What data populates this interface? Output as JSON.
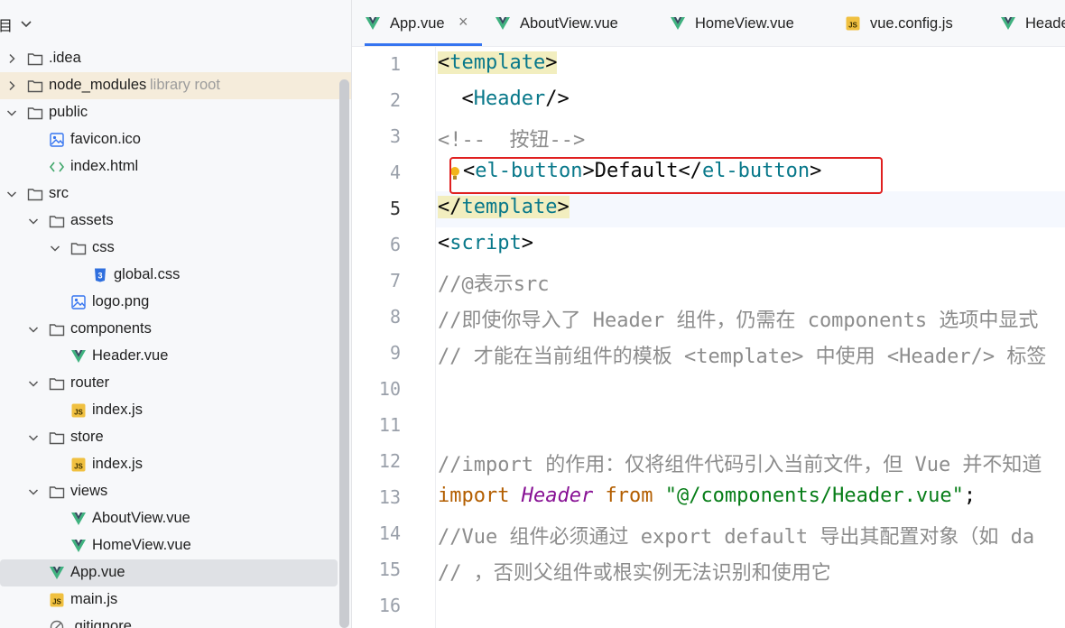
{
  "project": {
    "title": "目",
    "tree": [
      {
        "label": ".idea",
        "icon": "folder-icon",
        "state": "collapsed"
      },
      {
        "label": "node_modules",
        "hint": "library root",
        "icon": "folder-icon",
        "state": "collapsed"
      },
      {
        "label": "public",
        "icon": "folder-icon",
        "state": "expanded"
      },
      {
        "label": "favicon.ico",
        "icon": "image-file-icon"
      },
      {
        "label": "index.html",
        "icon": "html-file-icon"
      },
      {
        "label": "src",
        "icon": "folder-icon",
        "state": "expanded"
      },
      {
        "label": "assets",
        "icon": "folder-icon",
        "state": "expanded"
      },
      {
        "label": "css",
        "icon": "folder-icon",
        "state": "expanded"
      },
      {
        "label": "global.css",
        "icon": "css-file-icon"
      },
      {
        "label": "logo.png",
        "icon": "image-file-icon"
      },
      {
        "label": "components",
        "icon": "folder-icon",
        "state": "expanded"
      },
      {
        "label": "Header.vue",
        "icon": "vue-file-icon"
      },
      {
        "label": "router",
        "icon": "folder-icon",
        "state": "expanded"
      },
      {
        "label": "index.js",
        "icon": "js-file-icon"
      },
      {
        "label": "store",
        "icon": "folder-icon",
        "state": "expanded"
      },
      {
        "label": "index.js",
        "icon": "js-file-icon"
      },
      {
        "label": "views",
        "icon": "folder-icon",
        "state": "expanded"
      },
      {
        "label": "AboutView.vue",
        "icon": "vue-file-icon"
      },
      {
        "label": "HomeView.vue",
        "icon": "vue-file-icon"
      },
      {
        "label": "App.vue",
        "icon": "vue-file-icon",
        "selected": true
      },
      {
        "label": "main.js",
        "icon": "js-file-icon"
      },
      {
        "label": ".gitignore",
        "icon": "gitignore-icon"
      }
    ]
  },
  "editor": {
    "tabs": [
      {
        "label": "App.vue",
        "icon": "vue-file-icon",
        "active": true
      },
      {
        "label": "AboutView.vue",
        "icon": "vue-file-icon"
      },
      {
        "label": "HomeView.vue",
        "icon": "vue-file-icon"
      },
      {
        "label": "vue.config.js",
        "icon": "js-file-icon"
      },
      {
        "label": "Heade",
        "icon": "vue-file-icon"
      }
    ],
    "close_glyph": "×",
    "line_numbers": [
      "1",
      "2",
      "3",
      "4",
      "5",
      "6",
      "7",
      "8",
      "9",
      "10",
      "11",
      "12",
      "13",
      "14",
      "15",
      "16"
    ],
    "current_line": "5",
    "lines": {
      "l1": {
        "open": "<",
        "name": "template",
        "close": ">"
      },
      "l2": {
        "indent": "  ",
        "open": "<",
        "name": "Header",
        "close": "/>"
      },
      "l3": {
        "text": "<!--  按钮-->"
      },
      "l4": {
        "open": "<",
        "name": "el-button",
        "close": ">",
        "content": "Default",
        "end_open": "</",
        "end_name": "el-button",
        "end_close": ">"
      },
      "l5": {
        "open": "</",
        "name": "template",
        "close": ">"
      },
      "l6": {
        "open": "<",
        "name": "script",
        "close": ">"
      },
      "l7": {
        "text": "//@表示src"
      },
      "l8": {
        "text": "//即使你导入了 Header 组件，仍需在 components 选项中显式"
      },
      "l9": {
        "text": "// 才能在当前组件的模板 <template> 中使用 <Header/> 标签"
      },
      "l12": {
        "text": "//import 的作用：仅将组件代码引入当前文件，但 Vue 并不知道"
      },
      "l13": {
        "kw": "import",
        "ident": "Header",
        "from": "from",
        "str": "\"@/components/Header.vue\"",
        "semi": ";"
      },
      "l14": {
        "text": "//Vue 组件必须通过 export default 导出其配置对象（如 da"
      },
      "l15": {
        "text": "// ，否则父组件或根实例无法识别和使用它"
      }
    }
  },
  "colors": {
    "tag": "#08788a",
    "comment": "#8c8c8c",
    "keyword": "#b35e00",
    "string": "#067d17",
    "highlight_box": "#e02020",
    "vue": "#3fb27f"
  }
}
